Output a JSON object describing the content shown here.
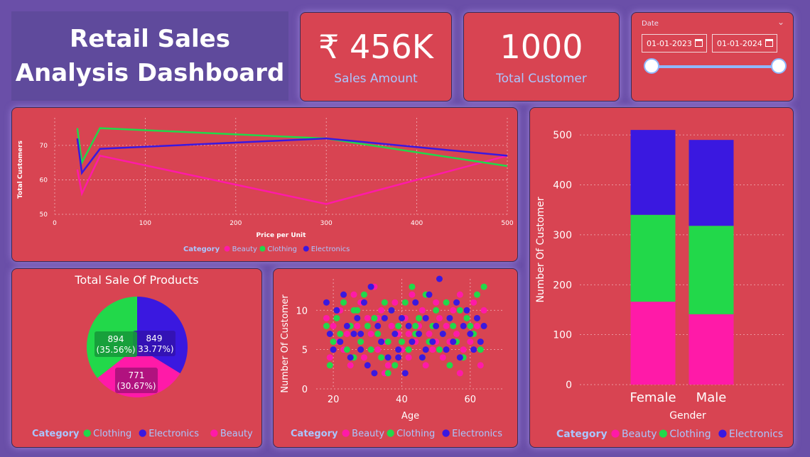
{
  "dashboard": {
    "title_line1": "Retail Sales",
    "title_line2": "Analysis Dashboard",
    "kpi_sales_value": "₹ 456K",
    "kpi_sales_label": "Sales Amount",
    "kpi_customers_value": "1000",
    "kpi_customers_label": "Total Customer"
  },
  "date_slicer": {
    "label": "Date",
    "start": "01-01-2023",
    "end": "01-01-2024",
    "range_start_fraction": 0,
    "range_end_fraction": 1
  },
  "colors": {
    "beauty": "#ff1aa8",
    "clothing": "#22d84a",
    "electronics": "#3a18e0",
    "panel": "#d84452",
    "accent_label": "#a9c6ff"
  },
  "chart_data": [
    {
      "id": "line",
      "type": "line",
      "xlabel": "Price per Unit",
      "ylabel": "Total Customers",
      "xlim": [
        0,
        500
      ],
      "ylim": [
        50,
        78
      ],
      "xticks": [
        0,
        100,
        200,
        300,
        400,
        500
      ],
      "yticks": [
        50,
        60,
        70
      ],
      "grid": true,
      "legend_title": "Category",
      "x": [
        25,
        30,
        50,
        300,
        500
      ],
      "series": [
        {
          "name": "Beauty",
          "key": "beauty",
          "values": [
            63,
            56,
            67,
            53,
            67
          ]
        },
        {
          "name": "Clothing",
          "key": "clothing",
          "values": [
            75,
            65,
            75,
            72,
            64
          ]
        },
        {
          "name": "Electronics",
          "key": "electronics",
          "values": [
            72,
            62,
            69,
            72,
            67
          ]
        }
      ]
    },
    {
      "id": "pie",
      "type": "pie",
      "title": "Total Sale Of Products",
      "legend_title": "Category",
      "slices": [
        {
          "name": "Electronics",
          "key": "electronics",
          "value": 849,
          "pct": "33.77%"
        },
        {
          "name": "Beauty",
          "key": "beauty",
          "value": 771,
          "pct": "30.67%"
        },
        {
          "name": "Clothing",
          "key": "clothing",
          "value": 894,
          "pct": "35.56%"
        }
      ],
      "legend_order": [
        "Clothing",
        "Electronics",
        "Beauty"
      ]
    },
    {
      "id": "scatter",
      "type": "scatter",
      "xlabel": "Age",
      "ylabel": "Number Of Customer",
      "xlim": [
        15,
        70
      ],
      "ylim": [
        0,
        14
      ],
      "xticks": [
        20,
        40,
        60
      ],
      "yticks": [
        0,
        5,
        10
      ],
      "grid": true,
      "legend_title": "Category",
      "series": [
        {
          "name": "Beauty",
          "key": "beauty",
          "points": [
            [
              18,
              9
            ],
            [
              19,
              4
            ],
            [
              20,
              8
            ],
            [
              21,
              6
            ],
            [
              22,
              10
            ],
            [
              23,
              5
            ],
            [
              24,
              7
            ],
            [
              25,
              3
            ],
            [
              26,
              12
            ],
            [
              27,
              8
            ],
            [
              28,
              6
            ],
            [
              29,
              4
            ],
            [
              30,
              9
            ],
            [
              31,
              7
            ],
            [
              32,
              13
            ],
            [
              33,
              5
            ],
            [
              34,
              10
            ],
            [
              35,
              6
            ],
            [
              36,
              3
            ],
            [
              37,
              8
            ],
            [
              38,
              11
            ],
            [
              39,
              7
            ],
            [
              40,
              5
            ],
            [
              41,
              9
            ],
            [
              42,
              4
            ],
            [
              43,
              12
            ],
            [
              44,
              6
            ],
            [
              45,
              8
            ],
            [
              46,
              10
            ],
            [
              47,
              3
            ],
            [
              48,
              7
            ],
            [
              49,
              5
            ],
            [
              50,
              11
            ],
            [
              51,
              9
            ],
            [
              52,
              4
            ],
            [
              53,
              8
            ],
            [
              54,
              6
            ],
            [
              55,
              10
            ],
            [
              56,
              7
            ],
            [
              57,
              12
            ],
            [
              58,
              5
            ],
            [
              59,
              9
            ],
            [
              60,
              6
            ],
            [
              61,
              11
            ],
            [
              62,
              8
            ],
            [
              63,
              3
            ],
            [
              64,
              10
            ],
            [
              28,
              11
            ],
            [
              35,
              2
            ],
            [
              42,
              7
            ],
            [
              50,
              6
            ],
            [
              57,
              2
            ],
            [
              33,
              9
            ]
          ]
        },
        {
          "name": "Clothing",
          "key": "clothing",
          "points": [
            [
              18,
              8
            ],
            [
              19,
              3
            ],
            [
              20,
              6
            ],
            [
              21,
              9
            ],
            [
              22,
              7
            ],
            [
              23,
              11
            ],
            [
              24,
              5
            ],
            [
              25,
              8
            ],
            [
              26,
              4
            ],
            [
              27,
              10
            ],
            [
              28,
              6
            ],
            [
              29,
              12
            ],
            [
              30,
              8
            ],
            [
              31,
              5
            ],
            [
              32,
              9
            ],
            [
              33,
              7
            ],
            [
              34,
              4
            ],
            [
              35,
              11
            ],
            [
              36,
              6
            ],
            [
              37,
              10
            ],
            [
              38,
              3
            ],
            [
              39,
              8
            ],
            [
              40,
              6
            ],
            [
              41,
              11
            ],
            [
              42,
              5
            ],
            [
              43,
              13
            ],
            [
              44,
              7
            ],
            [
              45,
              9
            ],
            [
              46,
              4
            ],
            [
              47,
              12
            ],
            [
              48,
              6
            ],
            [
              49,
              8
            ],
            [
              50,
              10
            ],
            [
              51,
              5
            ],
            [
              52,
              7
            ],
            [
              53,
              11
            ],
            [
              54,
              3
            ],
            [
              55,
              8
            ],
            [
              56,
              6
            ],
            [
              57,
              10
            ],
            [
              58,
              4
            ],
            [
              59,
              9
            ],
            [
              60,
              8
            ],
            [
              61,
              7
            ],
            [
              62,
              12
            ],
            [
              63,
              5
            ],
            [
              64,
              13
            ],
            [
              44,
              8
            ],
            [
              36,
              2
            ],
            [
              26,
              10
            ]
          ]
        },
        {
          "name": "Electronics",
          "key": "electronics",
          "points": [
            [
              18,
              11
            ],
            [
              19,
              7
            ],
            [
              20,
              5
            ],
            [
              21,
              10
            ],
            [
              22,
              6
            ],
            [
              23,
              12
            ],
            [
              24,
              8
            ],
            [
              25,
              4
            ],
            [
              26,
              7
            ],
            [
              27,
              9
            ],
            [
              28,
              5
            ],
            [
              29,
              11
            ],
            [
              30,
              3
            ],
            [
              31,
              13
            ],
            [
              32,
              2
            ],
            [
              33,
              8
            ],
            [
              34,
              6
            ],
            [
              35,
              9
            ],
            [
              36,
              4
            ],
            [
              37,
              10
            ],
            [
              38,
              7
            ],
            [
              39,
              5
            ],
            [
              40,
              9
            ],
            [
              41,
              2
            ],
            [
              42,
              8
            ],
            [
              43,
              6
            ],
            [
              44,
              11
            ],
            [
              45,
              7
            ],
            [
              46,
              4
            ],
            [
              47,
              9
            ],
            [
              48,
              12
            ],
            [
              49,
              6
            ],
            [
              50,
              8
            ],
            [
              51,
              14
            ],
            [
              52,
              7
            ],
            [
              53,
              5
            ],
            [
              54,
              9
            ],
            [
              55,
              6
            ],
            [
              56,
              11
            ],
            [
              57,
              4
            ],
            [
              58,
              8
            ],
            [
              59,
              10
            ],
            [
              60,
              7
            ],
            [
              61,
              5
            ],
            [
              62,
              9
            ],
            [
              63,
              6
            ],
            [
              64,
              8
            ],
            [
              28,
              7
            ],
            [
              39,
              4
            ],
            [
              47,
              5
            ]
          ]
        }
      ]
    },
    {
      "id": "stacked",
      "type": "bar",
      "stacked": true,
      "xlabel": "Gender",
      "ylabel": "Number Of Customer",
      "ylim": [
        0,
        540
      ],
      "yticks": [
        0,
        100,
        200,
        300,
        400,
        500
      ],
      "grid": true,
      "legend_title": "Category",
      "categories": [
        "Female",
        "Male"
      ],
      "series": [
        {
          "name": "Beauty",
          "key": "beauty",
          "values": [
            166,
            141
          ]
        },
        {
          "name": "Clothing",
          "key": "clothing",
          "values": [
            174,
            177
          ]
        },
        {
          "name": "Electronics",
          "key": "electronics",
          "values": [
            170,
            172
          ]
        }
      ]
    }
  ]
}
